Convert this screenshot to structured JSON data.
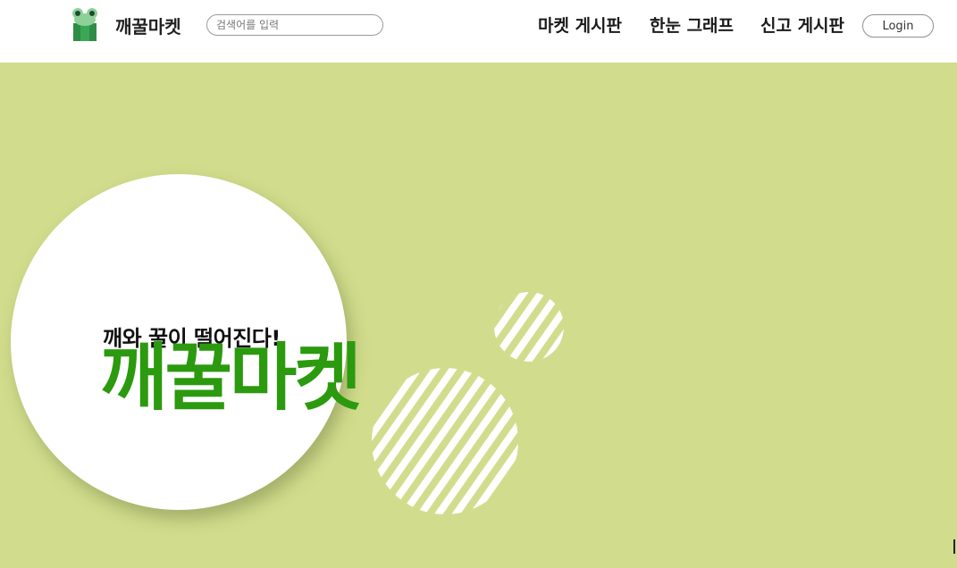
{
  "header": {
    "brand": "깨꿀마켓",
    "logo_icon": "frog-icon",
    "search": {
      "placeholder": "검색어를 입력",
      "value": ""
    },
    "nav": [
      {
        "label": "마켓 게시판"
      },
      {
        "label": "한눈 그래프"
      },
      {
        "label": "신고 게시판"
      }
    ],
    "login_label": "Login"
  },
  "hero": {
    "tagline": "깨와 꿀이 떨어진다!",
    "title": "깨꿀마켓",
    "colors": {
      "background": "#d1dd8c",
      "title": "#2b9a0f",
      "circle": "#ffffff"
    }
  }
}
